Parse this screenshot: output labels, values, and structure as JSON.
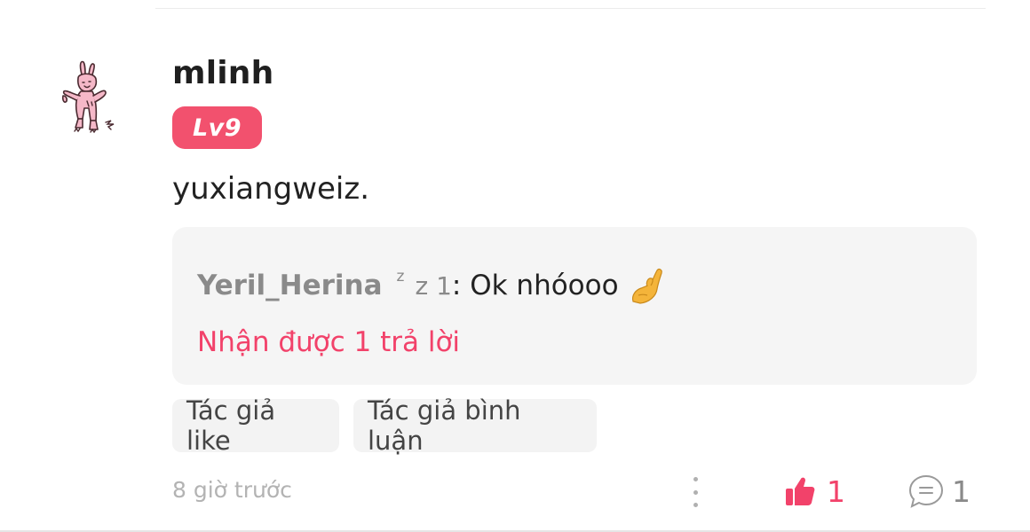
{
  "comment": {
    "username": "mlinh",
    "level": "Lv9",
    "text": "yuxiangweiz.",
    "avatar_icon": "pink-rabbit-avatar"
  },
  "reply_preview": {
    "author": "Yeril_Herina",
    "author_suffix_sup": "z",
    "author_suffix": "z 1",
    "separator": ":",
    "text": " Ok nhóooo",
    "emoji": "pinched-fingers-emoji",
    "reply_count_label": "Nhận được 1 trả lời"
  },
  "tags": {
    "author_like": "Tác giả like",
    "author_comment": "Tác giả bình luận"
  },
  "footer": {
    "timestamp": "8 giờ trước",
    "like_count": "1",
    "comment_count": "1"
  },
  "colors": {
    "accent": "#f2426a",
    "badge": "#f2516e",
    "muted": "#8a8a8a",
    "box_bg": "#f5f5f5"
  }
}
